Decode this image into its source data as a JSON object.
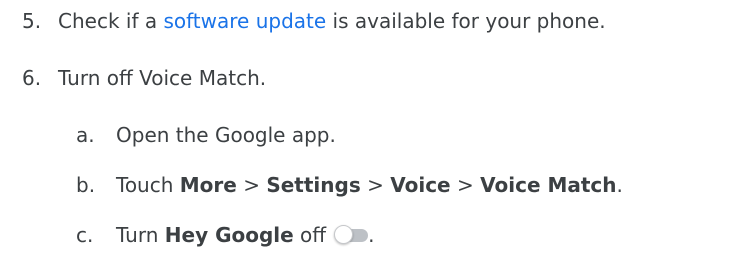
{
  "steps": [
    {
      "number": "5.",
      "before": "Check if a ",
      "link": "software update",
      "after": " is available for your phone."
    },
    {
      "number": "6.",
      "text": "Turn off Voice Match.",
      "substeps": [
        {
          "letter": "a.",
          "text": "Open the Google app."
        },
        {
          "letter": "b.",
          "prefix": "Touch ",
          "path": [
            "More",
            "Settings",
            "Voice",
            "Voice Match"
          ],
          "separator": " > ",
          "suffix": "."
        },
        {
          "letter": "c.",
          "prefix": "Turn ",
          "bold": "Hey Google",
          "middle": " off",
          "suffix": "."
        }
      ]
    }
  ],
  "toggle": {
    "state": "off",
    "icon": "toggle-off-icon",
    "track_color": "#bdc1c6",
    "thumb_color": "#ffffff"
  },
  "colors": {
    "text": "#3c4043",
    "link": "#1a73e8"
  }
}
